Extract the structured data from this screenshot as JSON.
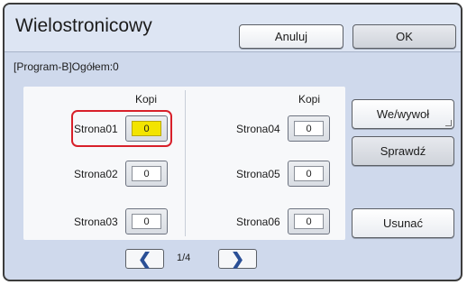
{
  "header": {
    "title": "Wielostronicowy",
    "cancel_label": "Anuluj",
    "ok_label": "OK"
  },
  "program_line": "[Program-B]Ogółem:0",
  "columns": {
    "left_header": "Kopi",
    "right_header": "Kopi"
  },
  "pages": [
    {
      "label": "Strona01",
      "value": "0",
      "selected": true
    },
    {
      "label": "Strona02",
      "value": "0"
    },
    {
      "label": "Strona03",
      "value": "0"
    },
    {
      "label": "Strona04",
      "value": "0"
    },
    {
      "label": "Strona05",
      "value": "0"
    },
    {
      "label": "Strona06",
      "value": "0"
    }
  ],
  "side_buttons": {
    "import_export": "We/wywoł",
    "check": "Sprawdź",
    "delete": "Usunać"
  },
  "pagination": {
    "indicator": "1/4",
    "prev_icon": "chevron-left-icon",
    "next_icon": "chevron-right-icon"
  },
  "colors": {
    "selected_value_bg": "#f3e400",
    "selection_ring": "#d8202a",
    "chevron": "#2a4f96"
  }
}
